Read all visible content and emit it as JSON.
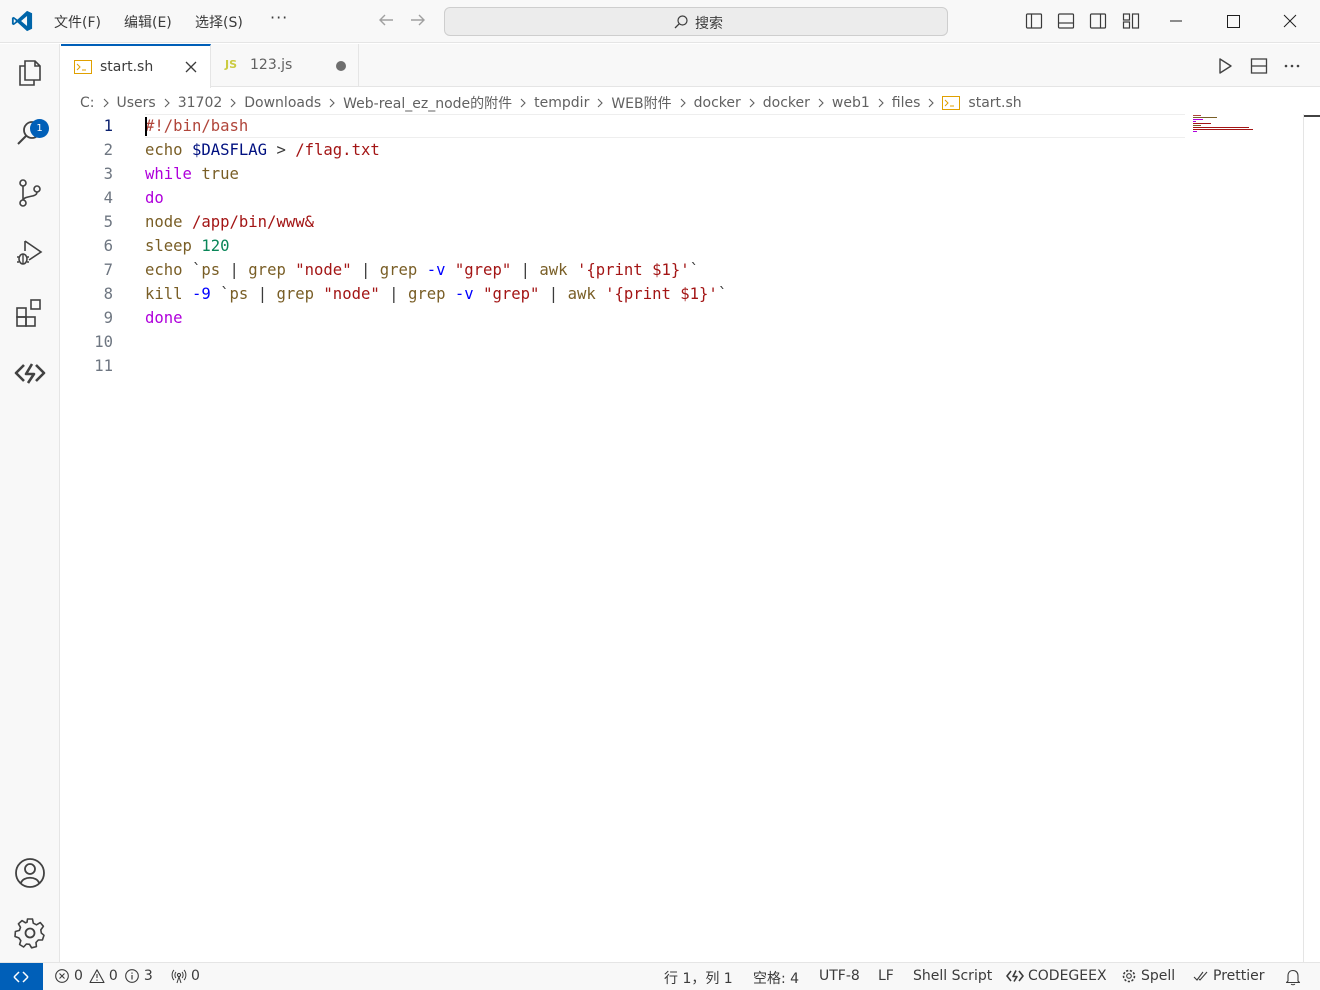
{
  "menu": {
    "file": "文件(F)",
    "edit": "编辑(E)",
    "select": "选择(S)",
    "more": "···"
  },
  "search": {
    "label": "搜索"
  },
  "activity": {
    "explorer_badge": "1"
  },
  "tabs": [
    {
      "label": "start.sh",
      "icon": "terminal-file-icon",
      "active": true
    },
    {
      "label": "123.js",
      "icon_text": "JS",
      "modified": true
    }
  ],
  "breadcrumb": [
    "C:",
    "Users",
    "31702",
    "Downloads",
    "Web-real_ez_node的附件",
    "tempdir",
    "WEB附件",
    "docker",
    "docker",
    "web1",
    "files",
    "start.sh"
  ],
  "editor": {
    "lines": [
      {
        "n": "1"
      },
      {
        "n": "2"
      },
      {
        "n": "3"
      },
      {
        "n": "4"
      },
      {
        "n": "5"
      },
      {
        "n": "6"
      },
      {
        "n": "7"
      },
      {
        "n": "8"
      },
      {
        "n": "9"
      },
      {
        "n": "10"
      },
      {
        "n": "11"
      }
    ],
    "code": {
      "l1_comment": "#!/bin/bash",
      "l2_cmd": "echo",
      "l2_var": "$DASFLAG",
      "l2_op": ">",
      "l2_str": "/flag.txt",
      "l3_kw": "while",
      "l3_cmd": "true",
      "l4_kw": "do",
      "l5_cmd": "node",
      "l5_str": "/app/bin/www&",
      "l6_cmd": "sleep",
      "l6_num": "120",
      "l7_cmd": "echo",
      "l7_tick": "`",
      "l7_ps": "ps",
      "l7_pipe1": "|",
      "l7_grep1": "grep",
      "l7_node": "\"node\"",
      "l7_pipe2": "|",
      "l7_grep2": "grep",
      "l7_flag": "-v",
      "l7_grepstr": "\"grep\"",
      "l7_pipe3": "|",
      "l7_awk": "awk",
      "l7_awkstr": "'{print $1}'",
      "l7_tick2": "`",
      "l8_cmd": "kill",
      "l8_flag": "-9",
      "l8_tick": "`",
      "l8_ps": "ps",
      "l8_pipe1": "|",
      "l8_grep1": "grep",
      "l8_node": "\"node\"",
      "l8_pipe2": "|",
      "l8_grep2": "grep",
      "l8_flag2": "-v",
      "l8_grepstr": "\"grep\"",
      "l8_pipe3": "|",
      "l8_awk": "awk",
      "l8_awkstr": "'{print $1}'",
      "l8_tick2": "`",
      "l9_kw": "done"
    }
  },
  "status": {
    "errors": "0",
    "warnings": "0",
    "infos": "3",
    "ports": "0",
    "position": "行 1，列 1",
    "indent": "空格: 4",
    "encoding": "UTF-8",
    "eol": "LF",
    "language": "Shell Script",
    "codegeex": "CODEGEEX",
    "spell": "Spell",
    "prettier": "Prettier"
  },
  "colors": {
    "accent": "#005fb8",
    "comment": "#b0453a",
    "command": "#795e26",
    "variable": "#001080",
    "string": "#a31515",
    "keyword": "#af00db",
    "number": "#098658",
    "operator": "#0000ff"
  }
}
